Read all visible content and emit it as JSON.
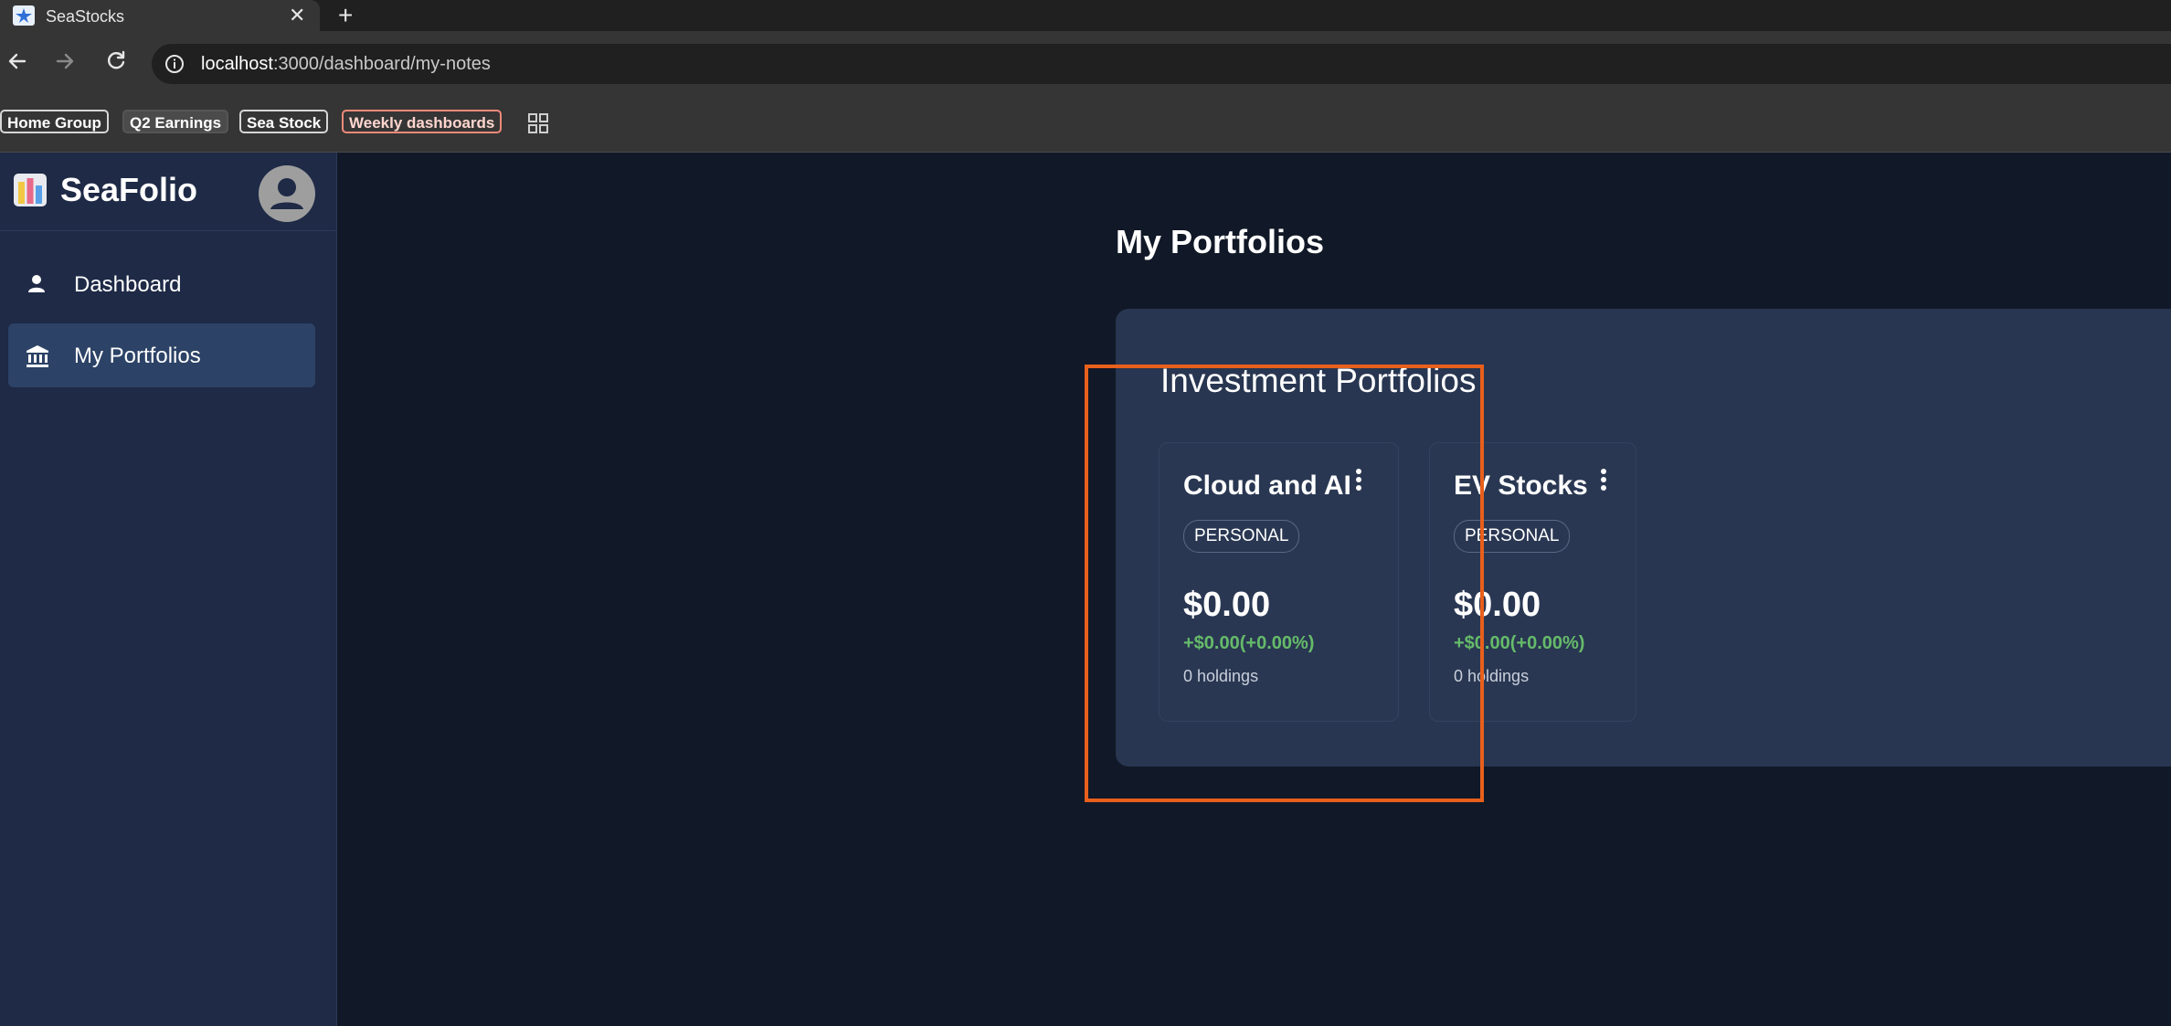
{
  "browser": {
    "tab_title": "SeaStocks",
    "close_glyph": "✕",
    "new_tab_glyph": "+",
    "url_host": "localhost",
    "url_path": ":3000/dashboard/my-notes",
    "bookmarks": [
      {
        "label": "Home Group",
        "style": "light"
      },
      {
        "label": "Q2 Earnings",
        "style": "dark"
      },
      {
        "label": "Sea Stock",
        "style": "light"
      },
      {
        "label": "Weekly dashboards",
        "style": "pink"
      }
    ]
  },
  "sidebar": {
    "brand_name": "SeaFolio",
    "items": [
      {
        "label": "Dashboard",
        "icon": "person-icon",
        "active": false
      },
      {
        "label": "My Portfolios",
        "icon": "bank-icon",
        "active": true
      }
    ]
  },
  "main": {
    "page_title": "My Portfolios",
    "panel_title": "Investment Portfolios",
    "cards": [
      {
        "name": "Cloud and AI",
        "tag": "PERSONAL",
        "value": "$0.00",
        "change": "+$0.00(+0.00%)",
        "holdings": "0 holdings"
      },
      {
        "name": "EV Stocks",
        "tag": "PERSONAL",
        "value": "$0.00",
        "change": "+$0.00(+0.00%)",
        "holdings": "0 holdings"
      }
    ]
  },
  "colors": {
    "background": "#111827",
    "sidebar": "#1e2a46",
    "panel": "#283651",
    "positive_change": "#66bb6a",
    "highlight": "#e8601c"
  }
}
